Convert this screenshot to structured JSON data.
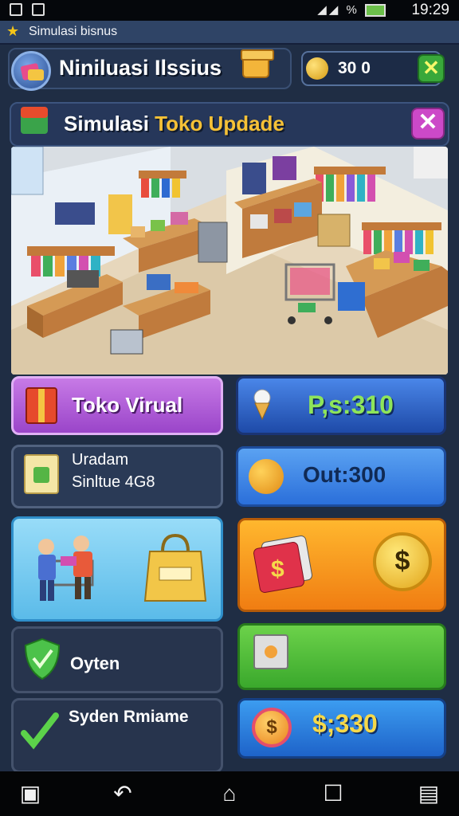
{
  "status_bar": {
    "time": "19:29",
    "icons": [
      "image-icon",
      "gallery-icon",
      "mute-icon",
      "signal-icon",
      "battery-icon"
    ],
    "battery_label": "%"
  },
  "app_bar": {
    "title": "Simulasi bisnus",
    "icon": "star-icon"
  },
  "header": {
    "title": "Niniluasi Ilssius",
    "coin_value": "30 0",
    "close_symbol": "✕"
  },
  "banner": {
    "title_part1": "Simulasi ",
    "title_part2": "Toko Updade",
    "close_symbol": "✕"
  },
  "tiles": {
    "toko_virtual": {
      "label": "Toko Virual"
    },
    "ps_value": {
      "label": "P,s:310"
    },
    "update_info": {
      "line1": "Uradam",
      "line2": "Sinltue 4G8"
    },
    "out_value": {
      "label": "Out:300"
    },
    "shoppers": {
      "bag_text": ""
    },
    "cards": {
      "coin_symbol": "$"
    },
    "option": {
      "label": "Oyten"
    },
    "lock_tile": {
      "label": ""
    },
    "system": {
      "label": "Syden Rmiame"
    },
    "money": {
      "label": "$;330",
      "coin_symbol": "$"
    }
  },
  "colors": {
    "background": "#1f2d44",
    "purple_tile": "#b264df",
    "blue_tile": "#2f66c8",
    "light_blue_tile": "#7dd0f3",
    "orange_tile": "#f59a20",
    "green_tile": "#52bd3a",
    "accent_yellow": "#f6c136"
  },
  "nav": {
    "buttons": [
      "screenshot-icon",
      "back-icon",
      "home-icon",
      "recents-icon",
      "menu-icon"
    ]
  }
}
